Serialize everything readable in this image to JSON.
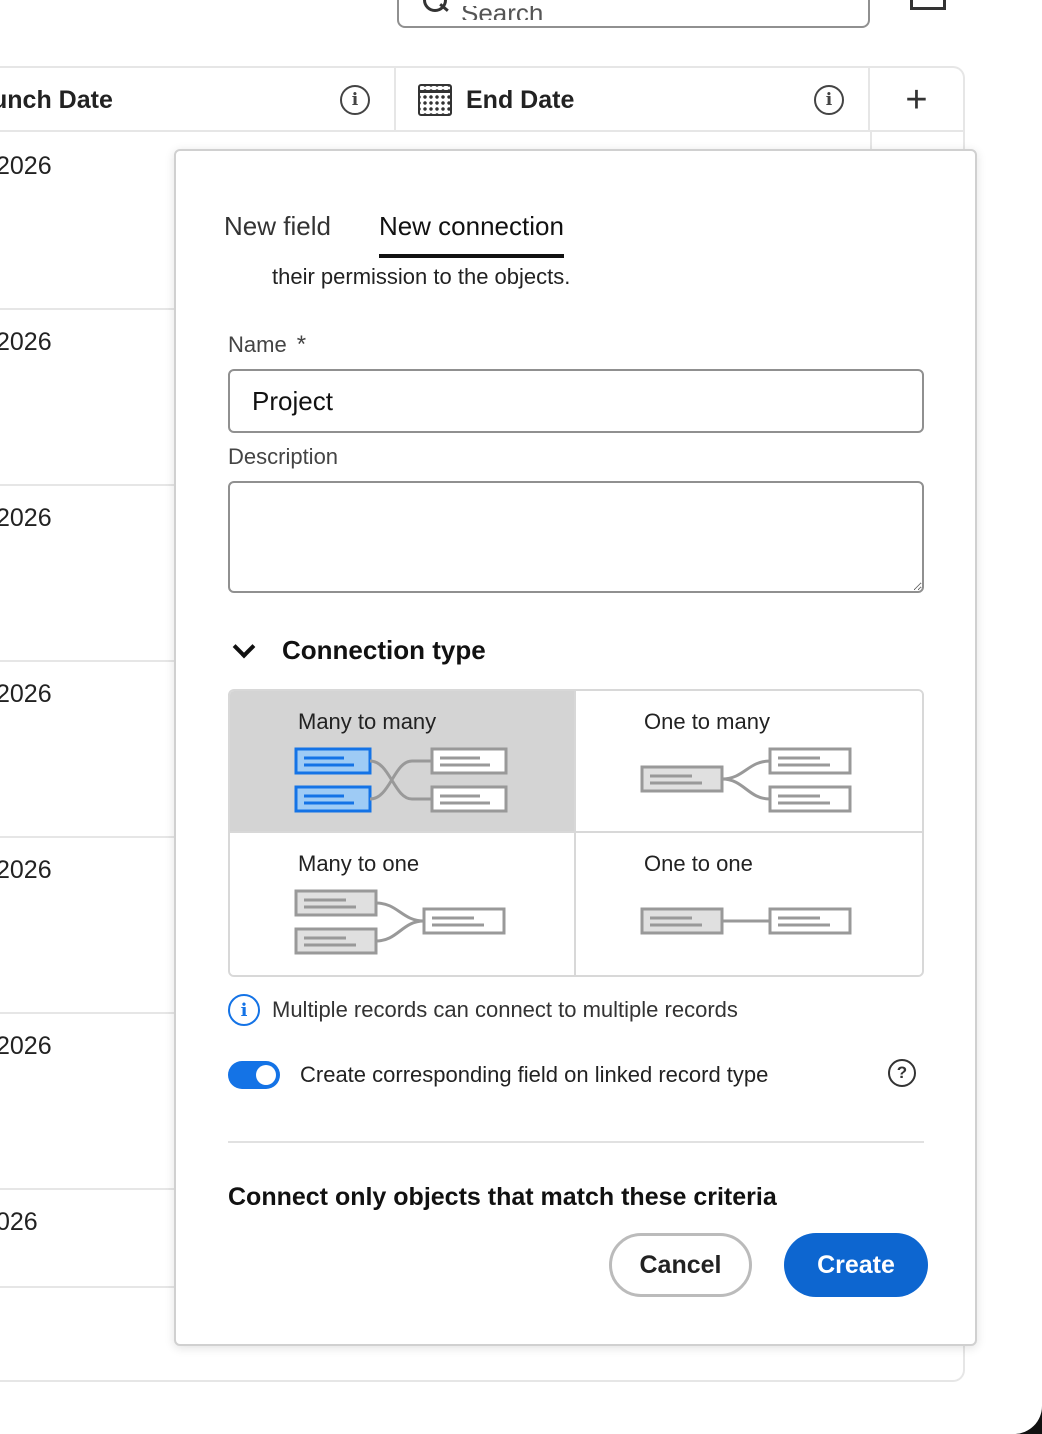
{
  "search": {
    "placeholder": "Search"
  },
  "table": {
    "columns": [
      {
        "label": "unch Date"
      },
      {
        "label": "End Date"
      }
    ],
    "rows": [
      "2026",
      "2026",
      "2026",
      "2026",
      "2026",
      "2026",
      "026"
    ]
  },
  "popover": {
    "tabs": [
      "New field",
      "New connection"
    ],
    "active_tab": "New connection",
    "description_text": "their permission to the objects.",
    "name_label": "Name",
    "required_mark": "*",
    "name_value": "Project",
    "description_label": "Description",
    "description_value": "",
    "connection_type_title": "Connection type",
    "connection_types": [
      {
        "label": "Many to many",
        "selected": true
      },
      {
        "label": "One to many",
        "selected": false
      },
      {
        "label": "Many to one",
        "selected": false
      },
      {
        "label": "One to one",
        "selected": false
      }
    ],
    "hint": "Multiple records can connect to multiple records",
    "toggle_label": "Create corresponding field on linked record type",
    "toggle_on": true,
    "criteria_title": "Connect only objects that match these criteria",
    "cancel_label": "Cancel",
    "create_label": "Create"
  },
  "colors": {
    "accent": "#0d66d0",
    "selected_bg": "#d4d4d4",
    "diagram_blue": "#1473e6"
  },
  "icons": [
    "search-icon",
    "fullscreen-icon",
    "info-icon",
    "calendar-icon",
    "plus-icon",
    "chevron-down-icon",
    "help-icon"
  ]
}
